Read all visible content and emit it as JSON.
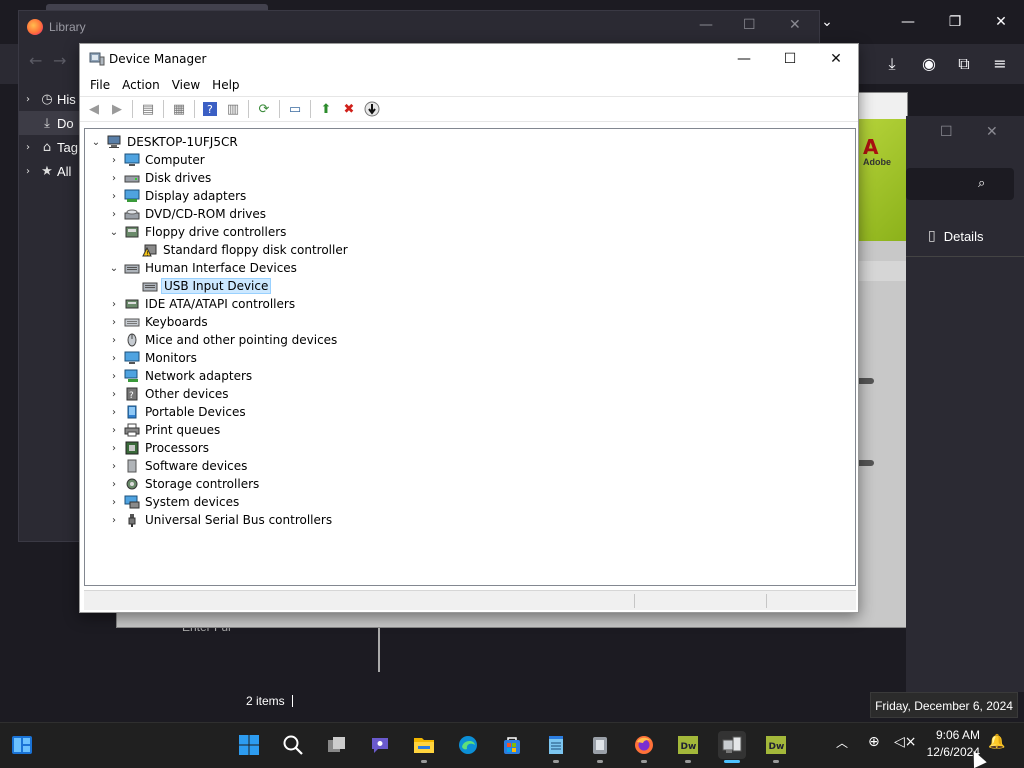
{
  "firefox": {
    "library_title": "Library",
    "library_tree": [
      {
        "label": "His",
        "icon": "clock-icon"
      },
      {
        "label": "Do",
        "icon": "download-icon"
      },
      {
        "label": "Tag",
        "icon": "tag-icon"
      },
      {
        "label": "All",
        "icon": "star-icon"
      }
    ],
    "details_label": "Details",
    "items_count": "2 items",
    "behind_text": "Enter Ful",
    "adobe_logo_text": "Adobe"
  },
  "device_manager": {
    "title": "Device Manager",
    "menu": [
      "File",
      "Action",
      "View",
      "Help"
    ],
    "toolbar": [
      "back-icon",
      "forward-icon",
      "properties-pane-icon",
      "details-icon",
      "help-icon",
      "view-icon",
      "scan-icon",
      "monitor-icon",
      "update-driver-icon",
      "uninstall-icon",
      "disable-icon"
    ],
    "root": "DESKTOP-1UFJ5CR",
    "nodes": [
      {
        "label": "Computer",
        "expanded": false
      },
      {
        "label": "Disk drives",
        "expanded": false
      },
      {
        "label": "Display adapters",
        "expanded": false
      },
      {
        "label": "DVD/CD-ROM drives",
        "expanded": false
      },
      {
        "label": "Floppy drive controllers",
        "expanded": true,
        "children": [
          "Standard floppy disk controller"
        ]
      },
      {
        "label": "Human Interface Devices",
        "expanded": true,
        "children": [
          "USB Input Device"
        ]
      },
      {
        "label": "IDE ATA/ATAPI controllers",
        "expanded": false
      },
      {
        "label": "Keyboards",
        "expanded": false
      },
      {
        "label": "Mice and other pointing devices",
        "expanded": false
      },
      {
        "label": "Monitors",
        "expanded": false
      },
      {
        "label": "Network adapters",
        "expanded": false
      },
      {
        "label": "Other devices",
        "expanded": false
      },
      {
        "label": "Portable Devices",
        "expanded": false
      },
      {
        "label": "Print queues",
        "expanded": false
      },
      {
        "label": "Processors",
        "expanded": false
      },
      {
        "label": "Software devices",
        "expanded": false
      },
      {
        "label": "Storage controllers",
        "expanded": false
      },
      {
        "label": "System devices",
        "expanded": false
      },
      {
        "label": "Universal Serial Bus controllers",
        "expanded": false
      }
    ],
    "selected": "USB Input Device"
  },
  "taskbar": {
    "apps": [
      "start",
      "search",
      "task-view",
      "chat",
      "file-explorer",
      "edge",
      "store",
      "notepad",
      "app",
      "firefox",
      "dreamweaver",
      "device-manager",
      "dreamweaver"
    ],
    "time": "9:06 AM",
    "date": "12/6/2024",
    "date_tooltip": "Friday, December 6, 2024"
  },
  "colors": {
    "accent": "#0078d4",
    "selection_bg": "#cce8ff",
    "taskbar_bg": "#202020",
    "firefox_bg": "#1c1b22"
  }
}
